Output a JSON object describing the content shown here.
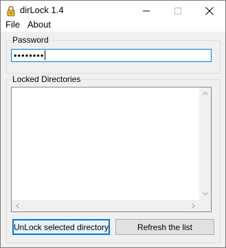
{
  "window": {
    "title": "dirLock 1.4",
    "icon": "padlock-icon"
  },
  "titlebar_buttons": [
    "minimize-icon",
    "maximize-icon",
    "close-icon"
  ],
  "menu": {
    "items": [
      {
        "label": "File"
      },
      {
        "label": "About"
      }
    ]
  },
  "password": {
    "group_label": "Password",
    "value_masked": "••••••••"
  },
  "locked_dirs": {
    "group_label": "Locked Directories",
    "items": []
  },
  "buttons": {
    "unlock_label": "UnLock selected directory",
    "refresh_label": "Refresh the list"
  },
  "colors": {
    "accent": "#0078d7",
    "window_bg": "#f0f0f0",
    "button_bg": "#e1e1e1"
  }
}
